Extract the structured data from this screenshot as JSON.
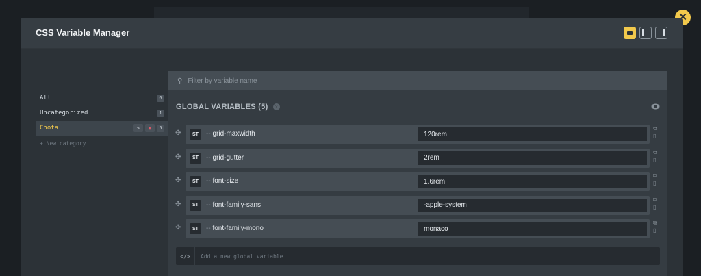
{
  "modal": {
    "title": "CSS Variable Manager",
    "close_glyph": "✕"
  },
  "layout_toggles": [
    {
      "name": "layout-full-icon",
      "active": true
    },
    {
      "name": "layout-left-icon",
      "active": false
    },
    {
      "name": "layout-right-icon",
      "active": false
    }
  ],
  "sidebar": {
    "items": [
      {
        "label": "All",
        "count": "6"
      },
      {
        "label": "Uncategorized",
        "count": "1"
      },
      {
        "label": "Chota",
        "count": "5",
        "active": true
      }
    ],
    "new_category": "+ New category"
  },
  "filter": {
    "placeholder": "Filter by variable name"
  },
  "section": {
    "title": "GLOBAL VARIABLES (5)",
    "help_glyph": "?"
  },
  "variables": [
    {
      "type": "ST",
      "prefix": "--",
      "name": "grid-maxwidth",
      "value": "120rem"
    },
    {
      "type": "ST",
      "prefix": "--",
      "name": "grid-gutter",
      "value": "2rem"
    },
    {
      "type": "ST",
      "prefix": "--",
      "name": "font-size",
      "value": "1.6rem"
    },
    {
      "type": "ST",
      "prefix": "--",
      "name": "font-family-sans",
      "value": "-apple-system"
    },
    {
      "type": "ST",
      "prefix": "--",
      "name": "font-family-mono",
      "value": "monaco"
    }
  ],
  "add_variable": {
    "icon_glyph": "</>",
    "placeholder": "Add a new global variable"
  },
  "colors": {
    "accent": "#f2c94c",
    "danger": "#e05c6b",
    "background": "#1b1f23",
    "modal": "#2c3237"
  }
}
